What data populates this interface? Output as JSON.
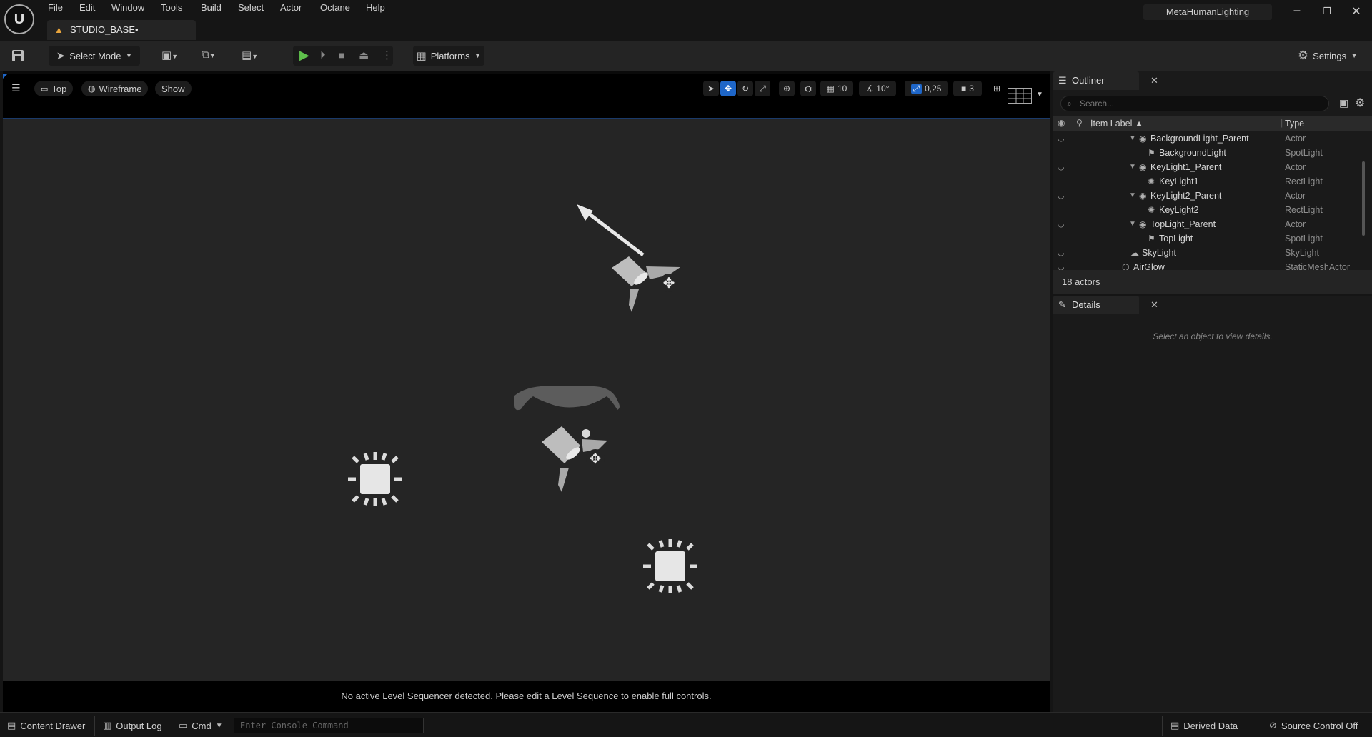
{
  "menu": {
    "logo": "U",
    "items": [
      "File",
      "Edit",
      "Window",
      "Tools",
      "Build",
      "Select",
      "Actor",
      "Octane",
      "Help"
    ],
    "project_name": "MetaHumanLighting",
    "window_controls": {
      "minimize": "–",
      "restore": "❐",
      "close": "✕"
    }
  },
  "level_tab": {
    "label": "STUDIO_BASE•",
    "warn_icon": "▲"
  },
  "toolbar": {
    "select_mode": "Select Mode",
    "platforms": "Platforms",
    "settings": "Settings"
  },
  "viewport": {
    "view_label": "Top",
    "render_mode": "Wireframe",
    "show_label": "Show",
    "grid_snap": "10",
    "rotation_snap": "10°",
    "scale_snap": "0,25",
    "camera_speed": "3",
    "status_message": "No active Level Sequencer detected. Please edit a Level Sequence to enable full controls."
  },
  "outliner": {
    "title": "Outliner",
    "search_placeholder": "Search...",
    "columns": {
      "label": "Item Label ▲",
      "type": "Type"
    },
    "rows": [
      {
        "label": "BackgroundLight_Parent",
        "type": "Actor",
        "indent": 2,
        "expandable": true,
        "icon": "actor-icon"
      },
      {
        "label": "BackgroundLight",
        "type": "SpotLight",
        "indent": 3,
        "expandable": false,
        "icon": "spotlight-icon"
      },
      {
        "label": "KeyLight1_Parent",
        "type": "Actor",
        "indent": 2,
        "expandable": true,
        "icon": "actor-icon"
      },
      {
        "label": "KeyLight1",
        "type": "RectLight",
        "indent": 3,
        "expandable": false,
        "icon": "rectlight-icon"
      },
      {
        "label": "KeyLight2_Parent",
        "type": "Actor",
        "indent": 2,
        "expandable": true,
        "icon": "actor-icon"
      },
      {
        "label": "KeyLight2",
        "type": "RectLight",
        "indent": 3,
        "expandable": false,
        "icon": "rectlight-icon"
      },
      {
        "label": "TopLight_Parent",
        "type": "Actor",
        "indent": 2,
        "expandable": true,
        "icon": "actor-icon"
      },
      {
        "label": "TopLight",
        "type": "SpotLight",
        "indent": 3,
        "expandable": false,
        "icon": "spotlight-icon"
      },
      {
        "label": "SkyLight",
        "type": "SkyLight",
        "indent": 1,
        "expandable": false,
        "icon": "skylight-icon"
      },
      {
        "label": "AirGlow",
        "type": "StaticMeshActor",
        "indent": 0,
        "expandable": false,
        "icon": "mesh-icon"
      }
    ],
    "actor_count": "18 actors"
  },
  "details": {
    "title": "Details",
    "empty_message": "Select an object to view details."
  },
  "bottombar": {
    "content_drawer": "Content Drawer",
    "output_log": "Output Log",
    "cmd": "Cmd",
    "console_placeholder": "Enter Console Command",
    "derived_data": "Derived Data",
    "source_control": "Source Control Off"
  }
}
